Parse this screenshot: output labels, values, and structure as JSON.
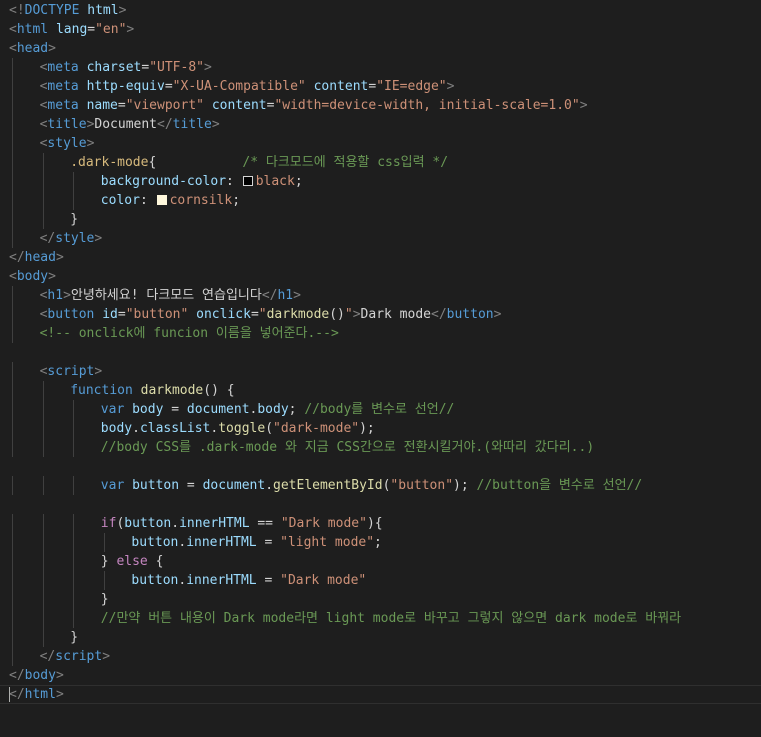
{
  "colors": {
    "background": "#1e1e1e",
    "tag": "#569cd6",
    "bracket": "#808080",
    "attr": "#9cdcfe",
    "string": "#ce9178",
    "text": "#d4d4d4",
    "comment": "#6a9955",
    "selector": "#d7ba7d",
    "func": "#dcdcaa",
    "keyword": "#569cd6",
    "control": "#c586c0",
    "guide": "#404040"
  },
  "lines": [
    {
      "indent": 0,
      "tokens": [
        [
          "bracket",
          "<!"
        ],
        [
          "tag",
          "DOCTYPE"
        ],
        [
          "text",
          " "
        ],
        [
          "attr",
          "html"
        ],
        [
          "bracket",
          ">"
        ]
      ]
    },
    {
      "indent": 0,
      "tokens": [
        [
          "bracket",
          "<"
        ],
        [
          "tag",
          "html"
        ],
        [
          "text",
          " "
        ],
        [
          "attr",
          "lang"
        ],
        [
          "text",
          "="
        ],
        [
          "string",
          "\"en\""
        ],
        [
          "bracket",
          ">"
        ]
      ]
    },
    {
      "indent": 0,
      "tokens": [
        [
          "bracket",
          "<"
        ],
        [
          "tag",
          "head"
        ],
        [
          "bracket",
          ">"
        ]
      ]
    },
    {
      "indent": 1,
      "tokens": [
        [
          "bracket",
          "<"
        ],
        [
          "tag",
          "meta"
        ],
        [
          "text",
          " "
        ],
        [
          "attr",
          "charset"
        ],
        [
          "text",
          "="
        ],
        [
          "string",
          "\"UTF-8\""
        ],
        [
          "bracket",
          ">"
        ]
      ]
    },
    {
      "indent": 1,
      "tokens": [
        [
          "bracket",
          "<"
        ],
        [
          "tag",
          "meta"
        ],
        [
          "text",
          " "
        ],
        [
          "attr",
          "http-equiv"
        ],
        [
          "text",
          "="
        ],
        [
          "string",
          "\"X-UA-Compatible\""
        ],
        [
          "text",
          " "
        ],
        [
          "attr",
          "content"
        ],
        [
          "text",
          "="
        ],
        [
          "string",
          "\"IE=edge\""
        ],
        [
          "bracket",
          ">"
        ]
      ]
    },
    {
      "indent": 1,
      "tokens": [
        [
          "bracket",
          "<"
        ],
        [
          "tag",
          "meta"
        ],
        [
          "text",
          " "
        ],
        [
          "attr",
          "name"
        ],
        [
          "text",
          "="
        ],
        [
          "string",
          "\"viewport\""
        ],
        [
          "text",
          " "
        ],
        [
          "attr",
          "content"
        ],
        [
          "text",
          "="
        ],
        [
          "string",
          "\"width=device-width, initial-scale=1.0\""
        ],
        [
          "bracket",
          ">"
        ]
      ]
    },
    {
      "indent": 1,
      "tokens": [
        [
          "bracket",
          "<"
        ],
        [
          "tag",
          "title"
        ],
        [
          "bracket",
          ">"
        ],
        [
          "text",
          "Document"
        ],
        [
          "bracket",
          "</"
        ],
        [
          "tag",
          "title"
        ],
        [
          "bracket",
          ">"
        ]
      ]
    },
    {
      "indent": 1,
      "tokens": [
        [
          "bracket",
          "<"
        ],
        [
          "tag",
          "style"
        ],
        [
          "bracket",
          ">"
        ]
      ]
    },
    {
      "indent": 2,
      "tokens": [
        [
          "selector",
          ".dark-mode"
        ],
        [
          "text",
          "{           "
        ],
        [
          "comment",
          "/* 다크모드에 적용할 css입력 */"
        ]
      ]
    },
    {
      "indent": 3,
      "tokens": [
        [
          "attr",
          "background-color"
        ],
        [
          "text",
          ": "
        ],
        [
          "swatch",
          "#000000"
        ],
        [
          "string",
          "black"
        ],
        [
          "text",
          ";"
        ]
      ]
    },
    {
      "indent": 3,
      "tokens": [
        [
          "attr",
          "color"
        ],
        [
          "text",
          ": "
        ],
        [
          "swatch",
          "#fff8dc"
        ],
        [
          "string",
          "cornsilk"
        ],
        [
          "text",
          ";"
        ]
      ]
    },
    {
      "indent": 2,
      "tokens": [
        [
          "text",
          "}"
        ]
      ]
    },
    {
      "indent": 1,
      "tokens": [
        [
          "bracket",
          "</"
        ],
        [
          "tag",
          "style"
        ],
        [
          "bracket",
          ">"
        ]
      ]
    },
    {
      "indent": 0,
      "tokens": [
        [
          "bracket",
          "</"
        ],
        [
          "tag",
          "head"
        ],
        [
          "bracket",
          ">"
        ]
      ]
    },
    {
      "indent": 0,
      "tokens": [
        [
          "bracket",
          "<"
        ],
        [
          "tag",
          "body"
        ],
        [
          "bracket",
          ">"
        ]
      ]
    },
    {
      "indent": 1,
      "tokens": [
        [
          "bracket",
          "<"
        ],
        [
          "tag",
          "h1"
        ],
        [
          "bracket",
          ">"
        ],
        [
          "text",
          "안녕하세요! 다크모드 연습입니다"
        ],
        [
          "bracket",
          "</"
        ],
        [
          "tag",
          "h1"
        ],
        [
          "bracket",
          ">"
        ]
      ]
    },
    {
      "indent": 1,
      "tokens": [
        [
          "bracket",
          "<"
        ],
        [
          "tag",
          "button"
        ],
        [
          "text",
          " "
        ],
        [
          "attr",
          "id"
        ],
        [
          "text",
          "="
        ],
        [
          "string",
          "\"button\""
        ],
        [
          "text",
          " "
        ],
        [
          "attr",
          "onclick"
        ],
        [
          "text",
          "="
        ],
        [
          "string",
          "\""
        ],
        [
          "func",
          "darkmode"
        ],
        [
          "text",
          "()"
        ],
        [
          "string",
          "\""
        ],
        [
          "bracket",
          ">"
        ],
        [
          "text",
          "Dark mode"
        ],
        [
          "bracket",
          "</"
        ],
        [
          "tag",
          "button"
        ],
        [
          "bracket",
          ">"
        ]
      ]
    },
    {
      "indent": 1,
      "tokens": [
        [
          "comment",
          "<!-- onclick에 funcion 이름을 넣어준다.-->"
        ]
      ]
    },
    {
      "indent": 0,
      "tokens": []
    },
    {
      "indent": 1,
      "tokens": [
        [
          "bracket",
          "<"
        ],
        [
          "tag",
          "script"
        ],
        [
          "bracket",
          ">"
        ]
      ]
    },
    {
      "indent": 2,
      "tokens": [
        [
          "keyword",
          "function"
        ],
        [
          "text",
          " "
        ],
        [
          "func",
          "darkmode"
        ],
        [
          "text",
          "() {"
        ]
      ]
    },
    {
      "indent": 3,
      "tokens": [
        [
          "keyword",
          "var"
        ],
        [
          "text",
          " "
        ],
        [
          "attr",
          "body"
        ],
        [
          "text",
          " = "
        ],
        [
          "attr",
          "document"
        ],
        [
          "text",
          "."
        ],
        [
          "attr",
          "body"
        ],
        [
          "text",
          "; "
        ],
        [
          "comment",
          "//body를 변수로 선언//"
        ]
      ]
    },
    {
      "indent": 3,
      "tokens": [
        [
          "attr",
          "body"
        ],
        [
          "text",
          "."
        ],
        [
          "attr",
          "classList"
        ],
        [
          "text",
          "."
        ],
        [
          "func",
          "toggle"
        ],
        [
          "text",
          "("
        ],
        [
          "string",
          "\"dark-mode\""
        ],
        [
          "text",
          ");"
        ]
      ]
    },
    {
      "indent": 3,
      "tokens": [
        [
          "comment",
          "//body CSS를 .dark-mode 와 지금 CSS간으로 전환시킬거야.(와따리 갔다리..)"
        ]
      ]
    },
    {
      "indent": 0,
      "tokens": []
    },
    {
      "indent": 3,
      "tokens": [
        [
          "keyword",
          "var"
        ],
        [
          "text",
          " "
        ],
        [
          "attr",
          "button"
        ],
        [
          "text",
          " = "
        ],
        [
          "attr",
          "document"
        ],
        [
          "text",
          "."
        ],
        [
          "func",
          "getElementById"
        ],
        [
          "text",
          "("
        ],
        [
          "string",
          "\"button\""
        ],
        [
          "text",
          "); "
        ],
        [
          "comment",
          "//button을 변수로 선언//"
        ]
      ]
    },
    {
      "indent": 0,
      "tokens": []
    },
    {
      "indent": 3,
      "tokens": [
        [
          "control",
          "if"
        ],
        [
          "text",
          "("
        ],
        [
          "attr",
          "button"
        ],
        [
          "text",
          "."
        ],
        [
          "attr",
          "innerHTML"
        ],
        [
          "text",
          " == "
        ],
        [
          "string",
          "\"Dark mode\""
        ],
        [
          "text",
          "){"
        ]
      ]
    },
    {
      "indent": 4,
      "tokens": [
        [
          "attr",
          "button"
        ],
        [
          "text",
          "."
        ],
        [
          "attr",
          "innerHTML"
        ],
        [
          "text",
          " = "
        ],
        [
          "string",
          "\"light mode\""
        ],
        [
          "text",
          ";"
        ]
      ]
    },
    {
      "indent": 3,
      "tokens": [
        [
          "text",
          "} "
        ],
        [
          "control",
          "else"
        ],
        [
          "text",
          " {"
        ]
      ]
    },
    {
      "indent": 4,
      "tokens": [
        [
          "attr",
          "button"
        ],
        [
          "text",
          "."
        ],
        [
          "attr",
          "innerHTML"
        ],
        [
          "text",
          " = "
        ],
        [
          "string",
          "\"Dark mode\""
        ]
      ]
    },
    {
      "indent": 3,
      "tokens": [
        [
          "text",
          "}"
        ]
      ]
    },
    {
      "indent": 3,
      "tokens": [
        [
          "comment",
          "//만약 버튼 내용이 Dark mode라면 light mode로 바꾸고 그렇지 않으면 dark mode로 바꿔라"
        ]
      ]
    },
    {
      "indent": 2,
      "tokens": [
        [
          "text",
          "}"
        ]
      ]
    },
    {
      "indent": 1,
      "tokens": [
        [
          "bracket",
          "</"
        ],
        [
          "tag",
          "script"
        ],
        [
          "bracket",
          ">"
        ]
      ]
    },
    {
      "indent": 0,
      "tokens": [
        [
          "bracket",
          "</"
        ],
        [
          "tag",
          "body"
        ],
        [
          "bracket",
          ">"
        ]
      ]
    },
    {
      "indent": 0,
      "tokens": [
        [
          "bracket",
          "</"
        ],
        [
          "tag",
          "html"
        ],
        [
          "bracket",
          ">"
        ]
      ]
    }
  ]
}
